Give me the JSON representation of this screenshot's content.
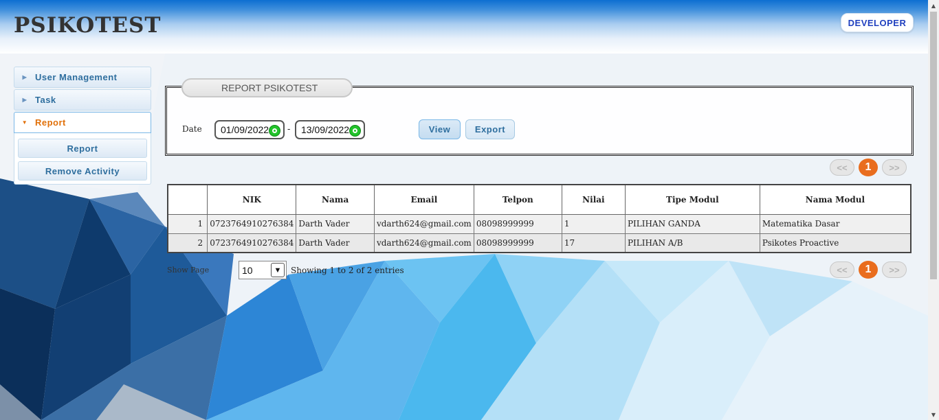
{
  "header": {
    "app_title": "PSIKOTEST",
    "user_button": "DEVELOPER"
  },
  "sidebar": {
    "items": [
      {
        "label": "User Management",
        "expanded": false
      },
      {
        "label": "Task",
        "expanded": false
      },
      {
        "label": "Report",
        "expanded": true,
        "children": [
          {
            "label": "Report"
          },
          {
            "label": "Remove Activity"
          }
        ]
      }
    ]
  },
  "report": {
    "title": "REPORT PSIKOTEST",
    "date_label": "Date",
    "date_from": "01/09/2022",
    "date_separator": "-",
    "date_to": "13/09/2022",
    "view_label": "View",
    "export_label": "Export"
  },
  "pagination": {
    "prev": "<<",
    "current": "1",
    "next": ">>"
  },
  "table": {
    "columns": [
      "",
      "NIK",
      "Nama",
      "Email",
      "Telpon",
      "Nilai",
      "Tipe Modul",
      "Nama Modul"
    ],
    "rows": [
      [
        "1",
        "0723764910276384",
        "Darth Vader",
        "vdarth624@gmail.com",
        "08098999999",
        "1",
        "PILIHAN GANDA",
        "Matematika Dasar"
      ],
      [
        "2",
        "0723764910276384",
        "Darth Vader",
        "vdarth624@gmail.com",
        "08098999999",
        "17",
        "PILIHAN A/B",
        "Psikotes Proactive"
      ]
    ]
  },
  "footer": {
    "show_page_label": "Show Page",
    "page_size": "10",
    "showing_text": "Showing 1 to 2 of 2 entries"
  },
  "colors": {
    "accent_orange": "#e96d1e",
    "link_blue": "#2e6e9e",
    "header_blue": "#0d6fd1"
  }
}
